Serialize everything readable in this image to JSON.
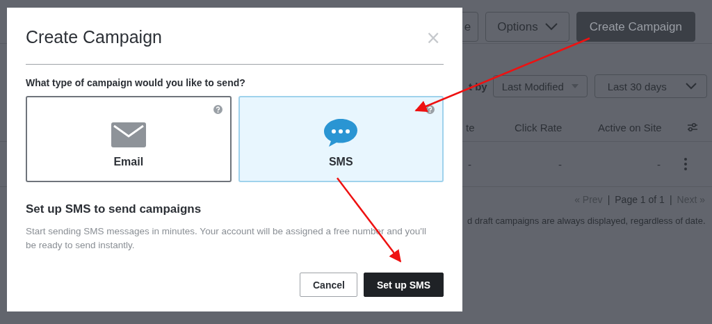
{
  "background": {
    "header_buttons": [
      {
        "label": "e",
        "kind": "outline"
      },
      {
        "label": "Options",
        "kind": "dropdown"
      },
      {
        "label": "Create Campaign",
        "kind": "primary"
      }
    ],
    "sort_label": "t by",
    "sort_select": "Last Modified",
    "date_select": "Last 30 days",
    "table": {
      "columns": [
        "te",
        "Click Rate",
        "Active on Site"
      ],
      "rows": [
        [
          "-",
          "-",
          "-"
        ]
      ]
    },
    "pagination": {
      "prev": "« Prev",
      "separator_1": "|",
      "page": "Page 1 of 1",
      "separator_2": "|",
      "next": "Next »"
    },
    "note": "d draft campaigns are always displayed, regardless of date."
  },
  "dialog": {
    "title": "Create Campaign",
    "close": "×",
    "question": "What type of campaign would you like to send?",
    "options": [
      {
        "label": "Email",
        "kind": "email",
        "selected": false
      },
      {
        "label": "SMS",
        "kind": "sms",
        "selected": true
      }
    ],
    "heading": "Set up SMS to send campaigns",
    "description": "Start sending SMS messages in minutes. Your account will be assigned a free number and you'll be ready to send instantly.",
    "buttons": [
      {
        "label": "Cancel",
        "kind": "secondary"
      },
      {
        "label": "Set up SMS",
        "kind": "primary"
      }
    ]
  }
}
